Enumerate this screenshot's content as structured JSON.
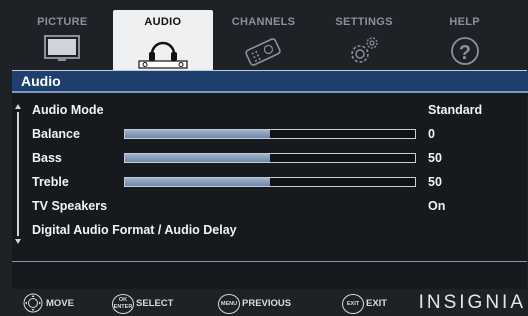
{
  "tabs": [
    {
      "label": "PICTURE",
      "icon": "tv-icon",
      "active": false
    },
    {
      "label": "AUDIO",
      "icon": "headphones-icon",
      "active": true
    },
    {
      "label": "CHANNELS",
      "icon": "remote-icon",
      "active": false
    },
    {
      "label": "SETTINGS",
      "icon": "gears-icon",
      "active": false
    },
    {
      "label": "HELP",
      "icon": "question-icon",
      "active": false
    }
  ],
  "panel": {
    "title": "Audio",
    "rows": [
      {
        "label": "Audio Mode",
        "value": "Standard"
      },
      {
        "label": "Balance",
        "value": "0",
        "level": 0.5
      },
      {
        "label": "Bass",
        "value": "50",
        "level": 0.5
      },
      {
        "label": "Treble",
        "value": "50",
        "level": 0.5
      },
      {
        "label": "TV Speakers",
        "value": "On"
      },
      {
        "label": "Digital Audio Format / Audio Delay",
        "value": ""
      }
    ]
  },
  "footer": {
    "move": "MOVE",
    "select": "SELECT",
    "select_btn_top": "OK",
    "select_btn_bottom": "ENTER",
    "previous": "PREVIOUS",
    "previous_btn": "MENU",
    "exit": "EXIT",
    "exit_btn": "EXIT",
    "brand": "INSIGNIA"
  },
  "colors": {
    "accent": "#1f3f6e",
    "bar_fill": "#8aa0bf",
    "active_tab": "#eef0f2"
  }
}
